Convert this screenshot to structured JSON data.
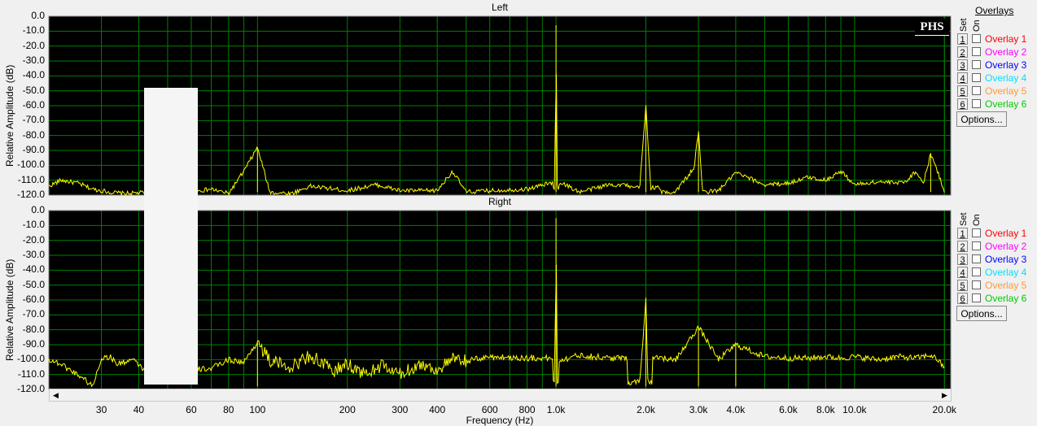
{
  "panels": [
    {
      "title": "Left",
      "ylabel": "Relative Amplitude (dB)",
      "options_label": "Options..."
    },
    {
      "title": "Right",
      "ylabel": "Relative Amplitude (dB)",
      "options_label": "Options..."
    }
  ],
  "yticks": [
    "0.0",
    "-10.0",
    "-20.0",
    "-30.0",
    "-40.0",
    "-50.0",
    "-60.0",
    "-70.0",
    "-80.0",
    "-90.0",
    "-100.0",
    "-110.0",
    "-120.0"
  ],
  "xticks": [
    {
      "label": "30",
      "hz": 30
    },
    {
      "label": "40",
      "hz": 40
    },
    {
      "label": "60",
      "hz": 60
    },
    {
      "label": "80",
      "hz": 80
    },
    {
      "label": "100",
      "hz": 100
    },
    {
      "label": "200",
      "hz": 200
    },
    {
      "label": "300",
      "hz": 300
    },
    {
      "label": "400",
      "hz": 400
    },
    {
      "label": "600",
      "hz": 600
    },
    {
      "label": "800",
      "hz": 800
    },
    {
      "label": "1.0k",
      "hz": 1000
    },
    {
      "label": "2.0k",
      "hz": 2000
    },
    {
      "label": "3.0k",
      "hz": 3000
    },
    {
      "label": "4.0k",
      "hz": 4000
    },
    {
      "label": "6.0k",
      "hz": 6000
    },
    {
      "label": "8.0k",
      "hz": 8000
    },
    {
      "label": "10.0k",
      "hz": 10000
    },
    {
      "label": "20.0k",
      "hz": 20000
    }
  ],
  "xlabel": "Frequency (Hz)",
  "overlays_title": "Overlays",
  "col_set": "Set",
  "col_on": "On",
  "overlays": [
    {
      "num": "1",
      "label": "Overlay 1",
      "color": "#ff0000"
    },
    {
      "num": "2",
      "label": "Overlay 2",
      "color": "#ff00ff"
    },
    {
      "num": "3",
      "label": "Overlay 3",
      "color": "#0000ff"
    },
    {
      "num": "4",
      "label": "Overlay 4",
      "color": "#00e0ff"
    },
    {
      "num": "5",
      "label": "Overlay 5",
      "color": "#ff9933"
    },
    {
      "num": "6",
      "label": "Overlay 6",
      "color": "#00cc00"
    }
  ],
  "logo": "PHS",
  "colors": {
    "plot_bg": "#000000",
    "grid": "#008000",
    "trace": "#ffff00"
  },
  "chart_data": [
    {
      "type": "line",
      "title": "Left",
      "xlabel": "Frequency (Hz)",
      "ylabel": "Relative Amplitude (dB)",
      "xscale": "log",
      "xlim": [
        20,
        21000
      ],
      "ylim": [
        -120,
        0
      ],
      "grid": true,
      "x": [
        20,
        22,
        25,
        28,
        32,
        36,
        45,
        55,
        70,
        80,
        90,
        100,
        110,
        130,
        150,
        200,
        250,
        300,
        400,
        450,
        500,
        600,
        800,
        950,
        1000,
        1050,
        1200,
        1500,
        2000,
        2500,
        2900,
        3000,
        3100,
        3500,
        4000,
        5000,
        6000,
        7000,
        8000,
        9000,
        10000,
        12000,
        14000,
        15000,
        16000,
        17000,
        18000,
        20000
      ],
      "y": [
        -114,
        -110,
        -112,
        -116,
        -118,
        -119,
        -118,
        -119,
        -116,
        -119,
        -104,
        -88,
        -118,
        -119,
        -114,
        -117,
        -113,
        -117,
        -117,
        -104,
        -118,
        -117,
        -116,
        -112,
        -6,
        -112,
        -118,
        -113,
        -60,
        -118,
        -102,
        -77,
        -118,
        -117,
        -105,
        -113,
        -112,
        -108,
        -110,
        -104,
        -113,
        -111,
        -112,
        -110,
        -104,
        -112,
        -92,
        -117
      ]
    },
    {
      "type": "line",
      "title": "Right",
      "xlabel": "Frequency (Hz)",
      "ylabel": "Relative Amplitude (dB)",
      "xscale": "log",
      "xlim": [
        20,
        21000
      ],
      "ylim": [
        -120,
        0
      ],
      "grid": true,
      "x": [
        20,
        22,
        24,
        26,
        28,
        30,
        32,
        34,
        38,
        42,
        46,
        55,
        70,
        80,
        90,
        100,
        110,
        130,
        150,
        180,
        200,
        230,
        260,
        300,
        350,
        400,
        450,
        500,
        600,
        800,
        950,
        1000,
        1050,
        1200,
        1500,
        2000,
        2200,
        2500,
        3000,
        3500,
        4000,
        5000,
        6000,
        7000,
        8000,
        9000,
        10000,
        12000,
        14000,
        16000,
        18000,
        19000,
        20000
      ],
      "y": [
        -100,
        -103,
        -108,
        -112,
        -118,
        -99,
        -98,
        -103,
        -100,
        -107,
        -98,
        -107,
        -106,
        -100,
        -102,
        -88,
        -101,
        -105,
        -97,
        -108,
        -103,
        -110,
        -104,
        -110,
        -103,
        -107,
        -100,
        -101,
        -98,
        -99,
        -99,
        -5,
        -100,
        -97,
        -99,
        -60,
        -98,
        -101,
        -78,
        -100,
        -90,
        -98,
        -99,
        -99,
        -98,
        -99,
        -98,
        -100,
        -98,
        -99,
        -97,
        -100,
        -106
      ]
    }
  ]
}
